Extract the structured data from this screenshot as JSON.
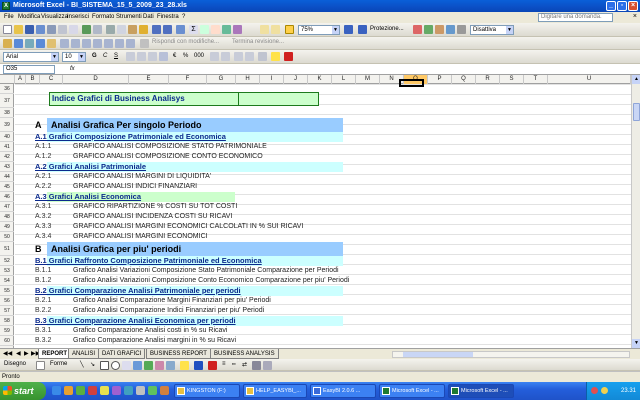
{
  "window": {
    "title": "Microsoft Excel - BI_SISTEMA_15_5_2009_23_28.xls"
  },
  "menu": {
    "items": [
      "File",
      "Modifica",
      "Visualizza",
      "Inserisci",
      "Formato",
      "Strumenti",
      "Dati",
      "Finestra",
      "?"
    ],
    "help_placeholder": "Digitare una domanda."
  },
  "toolbar": {
    "zoom": "75%",
    "protection_label": "Protezione...",
    "disattiva_label": "Disattiva",
    "review_label": "Rispondi con modifiche...",
    "end_review_label": "Termina revisione..."
  },
  "format_toolbar": {
    "font": "Arial",
    "size": "10"
  },
  "formula_bar": {
    "name_box": "O35",
    "fx": "fx",
    "content": ""
  },
  "columns": [
    "A",
    "B",
    "C",
    "D",
    "E",
    "F",
    "G",
    "H",
    "I",
    "J",
    "K",
    "L",
    "M",
    "N",
    "O",
    "P",
    "Q",
    "R",
    "S",
    "T",
    "U"
  ],
  "selected_column": "O",
  "rows": [
    "36",
    "37",
    "38",
    "39",
    "40",
    "41",
    "42",
    "43",
    "44",
    "45",
    "46",
    "47",
    "48",
    "49",
    "50",
    "51",
    "52",
    "53",
    "54",
    "55",
    "56",
    "57",
    "58",
    "59",
    "60"
  ],
  "sheet": {
    "title": "Indice Grafici di Business Analisys",
    "sections": [
      {
        "code": "A",
        "title": "Analisi Grafica Per singolo Periodo"
      },
      {
        "code": "B",
        "title": "Analisi Grafica per piu' periodi"
      }
    ],
    "subsections": {
      "a1": {
        "title": "A.1  Grafici Composizione  Patrimoniale ed Economica"
      },
      "a2": {
        "title": "A.2  Grafici Analisi Patrimoniale"
      },
      "a3": {
        "title": "A.3  Grafici Analisi Economica"
      },
      "b1": {
        "title": "B.1  Grafici Raffronto Composizione  Patrimoniale ed Economica"
      },
      "b2": {
        "title": "B.2  Grafici Comparazione Analisi Patrimoniale per periodi"
      },
      "b3": {
        "title": "B.3  Grafici Comparazione Analisi Economica per periodi"
      }
    },
    "items": {
      "a11": {
        "code": "A.1.1",
        "desc": "GRAFICO ANALISI COMPOSIZIONE STATO PATRIMONIALE"
      },
      "a12": {
        "code": "A.1.2",
        "desc": "GRAFICO ANALISI COMPOSIZIONE CONTO ECONOMICO"
      },
      "a21": {
        "code": "A.2.1",
        "desc": "GRAFICO ANALISI MARGINI DI LIQUIDITA'"
      },
      "a22": {
        "code": "A.2.2",
        "desc": "GRAFICO ANALISI INDICI FINANZIARI"
      },
      "a31": {
        "code": "A.3.1",
        "desc": "GRAFICO RIPARTIZIONE % COSTI SU TOT COSTI"
      },
      "a32": {
        "code": "A.3.2",
        "desc": "GRAFICO ANALISI INCIDENZA COSTI SU RICAVI"
      },
      "a33": {
        "code": "A.3.3",
        "desc": "GRAFICO ANALISI MARGINI ECONOMICI CALCOLATI IN % SUI RICAVI"
      },
      "a34": {
        "code": "A.3.4",
        "desc": "GRAFICO ANALISI MARGINI ECONOMICI"
      },
      "b11": {
        "code": "B.1.1",
        "desc": "Grafico Analisi Variazioni Composizione Stato Patrimoniale Comparazione per Periodi"
      },
      "b12": {
        "code": "B.1.2",
        "desc": "Grafico Analisi Variazioni Composizione Conto Economico Comparazione per piu' Periodi"
      },
      "b21": {
        "code": "B.2.1",
        "desc": "Grafico Analisi Comparazione Margini Finanziari per piu' Periodi"
      },
      "b22": {
        "code": "B.2.2",
        "desc": "Grafico Analisi Comparazione Indici Finanziari per piu' Periodi"
      },
      "b31": {
        "code": "B.3.1",
        "desc": "Grafico Comparazione Analisi costi in % su Ricavi"
      },
      "b32": {
        "code": "B.3.2",
        "desc": "Grafico Comparazione Analisi margini in % su Ricavi"
      }
    }
  },
  "sheet_tabs": [
    "REPORT",
    "ANALISI",
    "DATI GRAFICI",
    "BUSINESS REPORT",
    "BUSINESS ANALYSIS"
  ],
  "active_tab": "REPORT",
  "draw_toolbar": {
    "draw_label": "Disegno",
    "shapes_label": "Forme"
  },
  "status": {
    "text": "Pronto"
  },
  "taskbar": {
    "start_label": "start",
    "tasks": [
      "KINGSTON (F:)",
      "HELP_EASYBI_...",
      "EasyBI   2.0.6 ...",
      "Microsoft Excel - ...",
      "Microsoft Excel - ..."
    ],
    "clock": "23.31"
  }
}
